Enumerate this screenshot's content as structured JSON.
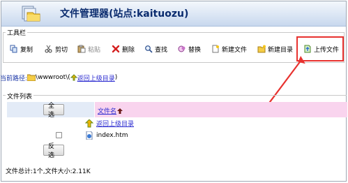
{
  "header": {
    "title": "文件管理器(站点:kaituozu)"
  },
  "toolbar": {
    "legend": "工具栏",
    "items": [
      {
        "label": "复制",
        "icon": "copy-icon",
        "enabled": true
      },
      {
        "label": "剪切",
        "icon": "scissors-icon",
        "enabled": true
      },
      {
        "label": "粘贴",
        "icon": "paste-icon",
        "enabled": false
      },
      {
        "label": "删除",
        "icon": "delete-x-icon",
        "enabled": true
      },
      {
        "label": "查找",
        "icon": "search-icon",
        "enabled": true
      },
      {
        "label": "替换",
        "icon": "replace-icon",
        "enabled": true
      },
      {
        "label": "新建文件",
        "icon": "new-file-icon",
        "enabled": true
      },
      {
        "label": "新建目录",
        "icon": "new-folder-icon",
        "enabled": true
      },
      {
        "label": "上传文件",
        "icon": "upload-icon",
        "enabled": true
      }
    ]
  },
  "path": {
    "label": "当前路径:",
    "value": "\\wwwroot\\(",
    "up_link": "返回上级目录",
    "close": ")"
  },
  "file_list": {
    "legend": "文件列表",
    "select_all": "全选",
    "invert": "反选",
    "column_name": "文件名",
    "rows": [
      {
        "name": "返回上级目录",
        "type": "up",
        "icon": "up-folder-icon"
      },
      {
        "name": "index.htm",
        "type": "file",
        "icon": "html-file-icon"
      }
    ],
    "summary": "文件总计:1个,文件大小:2.11K"
  },
  "colors": {
    "highlight": "#e8322f",
    "link": "#2b2bd0",
    "header_bg": "#c8d8ee"
  }
}
